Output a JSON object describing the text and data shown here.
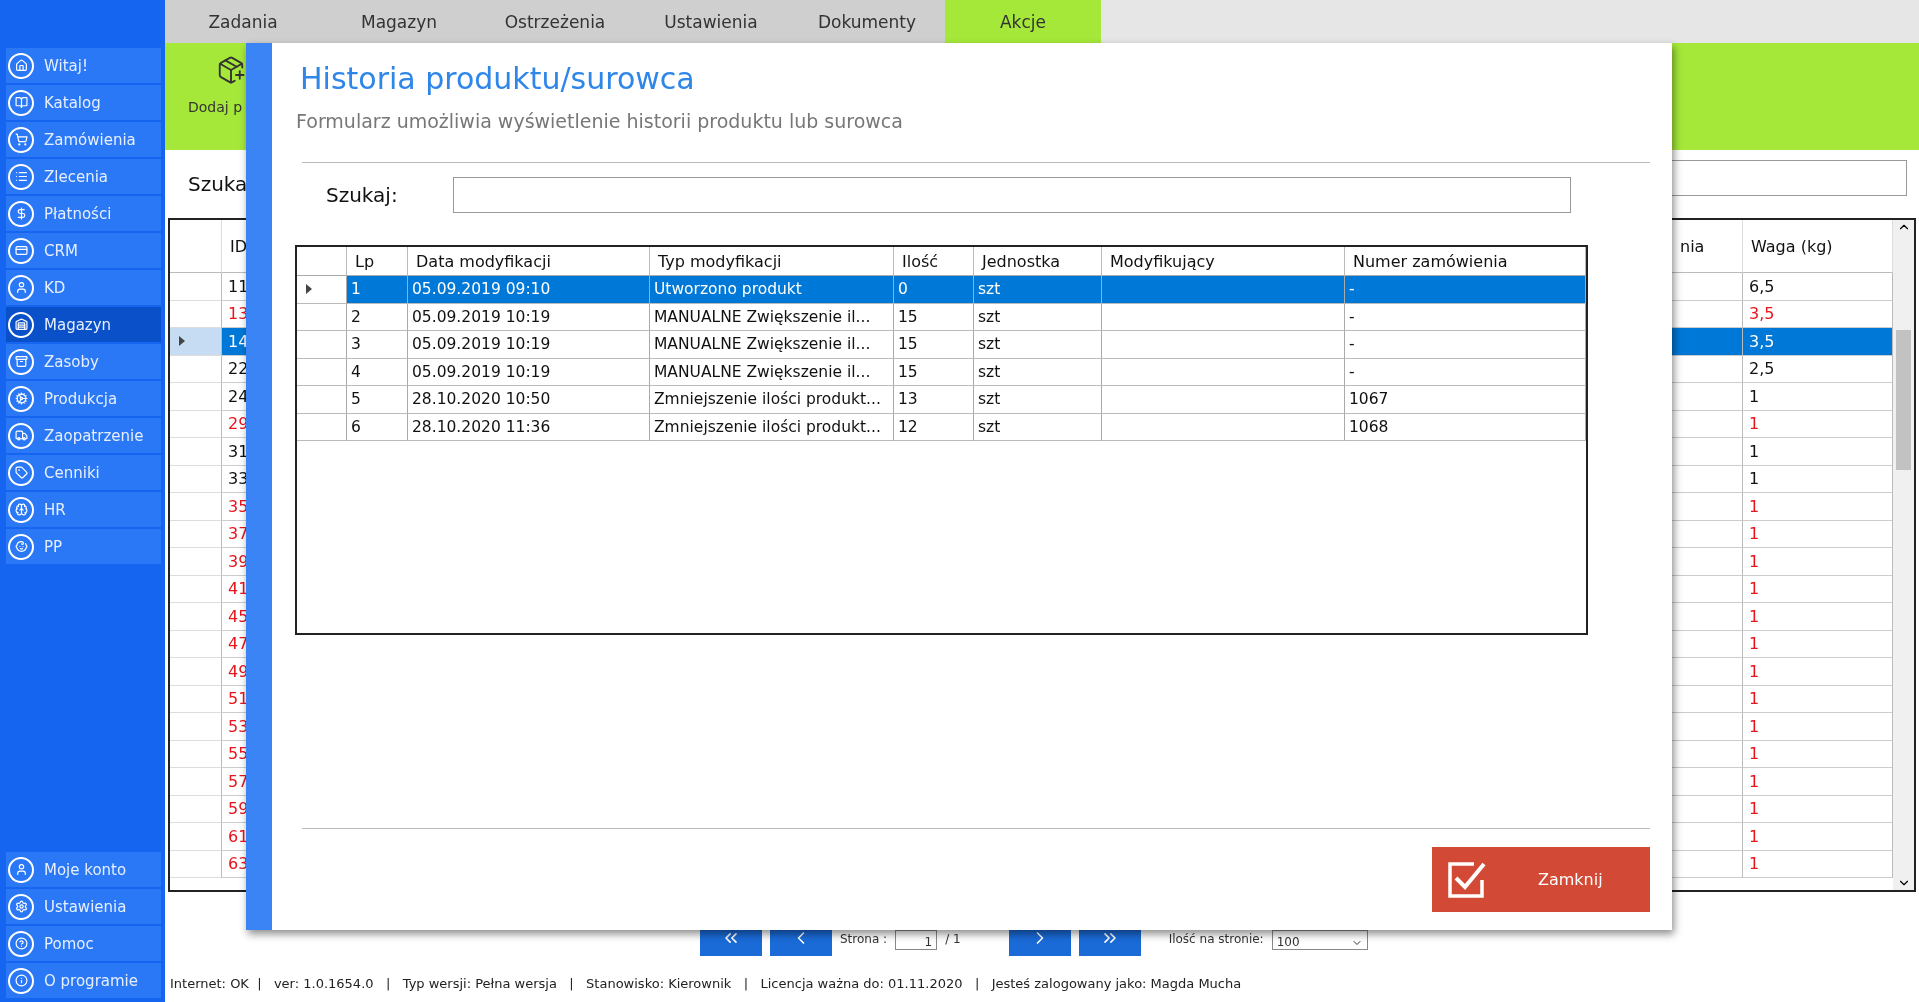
{
  "sidebar": {
    "items": [
      {
        "label": "Witaj!",
        "selected": false
      },
      {
        "label": "Katalog",
        "selected": false
      },
      {
        "label": "Zamówienia",
        "selected": false
      },
      {
        "label": "Zlecenia",
        "selected": false
      },
      {
        "label": "Płatności",
        "selected": false
      },
      {
        "label": "CRM",
        "selected": false
      },
      {
        "label": "KD",
        "selected": false
      },
      {
        "label": "Magazyn",
        "selected": true
      },
      {
        "label": "Zasoby",
        "selected": false
      },
      {
        "label": "Produkcja",
        "selected": false
      },
      {
        "label": "Zaopatrzenie",
        "selected": false
      },
      {
        "label": "Cenniki",
        "selected": false
      },
      {
        "label": "HR",
        "selected": false
      },
      {
        "label": "PP",
        "selected": false
      }
    ],
    "bottom_items": [
      {
        "label": "Moje konto"
      },
      {
        "label": "Ustawienia"
      },
      {
        "label": "Pomoc"
      },
      {
        "label": "O programie"
      }
    ]
  },
  "tabs": [
    {
      "label": "Zadania",
      "selected": false
    },
    {
      "label": "Magazyn",
      "selected": false
    },
    {
      "label": "Ostrzeżenia",
      "selected": false
    },
    {
      "label": "Ustawienia",
      "selected": false
    },
    {
      "label": "Dokumenty",
      "selected": false
    },
    {
      "label": "Akcje",
      "selected": true
    }
  ],
  "ribbon": {
    "button_label": "Dodaj p"
  },
  "search": {
    "label": "Szuka"
  },
  "table": {
    "columns": [
      "ID",
      "nia",
      "Waga (kg)"
    ],
    "rows": [
      {
        "id": "11",
        "weight": "6,5",
        "alert": false,
        "selected": false
      },
      {
        "id": "13",
        "weight": "3,5",
        "alert": true,
        "selected": false
      },
      {
        "id": "14",
        "weight": "3,5",
        "alert": false,
        "selected": true
      },
      {
        "id": "22",
        "weight": "2,5",
        "alert": false,
        "selected": false
      },
      {
        "id": "24",
        "weight": "1",
        "alert": false,
        "selected": false
      },
      {
        "id": "29",
        "weight": "1",
        "alert": true,
        "selected": false
      },
      {
        "id": "31",
        "weight": "1",
        "alert": false,
        "selected": false
      },
      {
        "id": "33",
        "weight": "1",
        "alert": false,
        "selected": false
      },
      {
        "id": "35",
        "weight": "1",
        "alert": true,
        "selected": false
      },
      {
        "id": "37",
        "weight": "1",
        "alert": true,
        "selected": false
      },
      {
        "id": "39",
        "weight": "1",
        "alert": true,
        "selected": false
      },
      {
        "id": "41",
        "weight": "1",
        "alert": true,
        "selected": false
      },
      {
        "id": "45",
        "weight": "1",
        "alert": true,
        "selected": false
      },
      {
        "id": "47",
        "weight": "1",
        "alert": true,
        "selected": false
      },
      {
        "id": "49",
        "weight": "1",
        "alert": true,
        "selected": false
      },
      {
        "id": "51",
        "weight": "1",
        "alert": true,
        "selected": false
      },
      {
        "id": "53",
        "weight": "1",
        "alert": true,
        "selected": false
      },
      {
        "id": "55",
        "weight": "1",
        "alert": true,
        "selected": false
      },
      {
        "id": "57",
        "weight": "1",
        "alert": true,
        "selected": false
      },
      {
        "id": "59",
        "weight": "1",
        "alert": true,
        "selected": false
      },
      {
        "id": "61",
        "weight": "1",
        "alert": true,
        "selected": false
      },
      {
        "id": "63",
        "weight": "1",
        "alert": true,
        "selected": false
      }
    ]
  },
  "pagination": {
    "page_label": "Strona :",
    "page": "1",
    "total": "/ 1",
    "per_page_label": "Ilość na stronie:",
    "per_page": "100"
  },
  "status_bar": "Internet: OK  |   ver: 1.0.1654.0   |   Typ wersji: Pełna wersja   |   Stanowisko: Kierownik   |   Licencja ważna do: 01.11.2020   |   Jesteś zalogowany jako: Magda Mucha",
  "dialog": {
    "title": "Historia produktu/surowca",
    "subtitle": "Formularz umożliwia wyświetlenie historii produktu lub surowca",
    "search_label": "Szukaj:",
    "columns": [
      "Lp",
      "Data modyfikacji",
      "Typ modyfikacji",
      "Ilość",
      "Jednostka",
      "Modyfikujący",
      "Numer zamówienia"
    ],
    "rows": [
      {
        "cells": [
          "1",
          "05.09.2019 09:10",
          "Utworzono produkt",
          "0",
          "szt",
          "",
          "-"
        ],
        "selected": true
      },
      {
        "cells": [
          "2",
          "05.09.2019 10:19",
          "MANUALNE Zwiększenie il...",
          "15",
          "szt",
          "",
          "-"
        ],
        "selected": false
      },
      {
        "cells": [
          "3",
          "05.09.2019 10:19",
          "MANUALNE Zwiększenie il...",
          "15",
          "szt",
          "",
          "-"
        ],
        "selected": false
      },
      {
        "cells": [
          "4",
          "05.09.2019 10:19",
          "MANUALNE Zwiększenie il...",
          "15",
          "szt",
          "",
          "-"
        ],
        "selected": false
      },
      {
        "cells": [
          "5",
          "28.10.2020 10:50",
          "Zmniejszenie ilości produkt...",
          "13",
          "szt",
          "",
          "1067"
        ],
        "selected": false
      },
      {
        "cells": [
          "6",
          "28.10.2020 11:36",
          "Zmniejszenie ilości produkt...",
          "12",
          "szt",
          "",
          "1068"
        ],
        "selected": false
      }
    ],
    "close_button": "Zamknij"
  }
}
